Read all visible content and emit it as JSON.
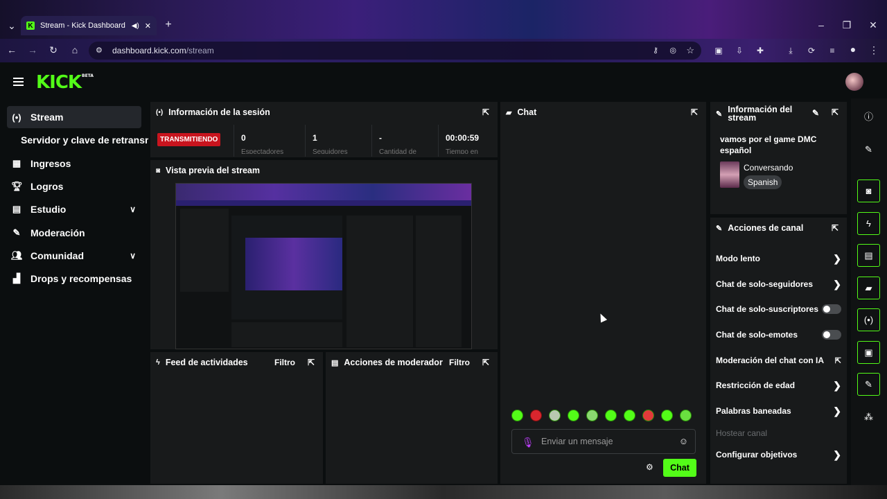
{
  "browser": {
    "tab_title": "Stream - Kick Dashboard",
    "url_domain": "dashboard.kick.com",
    "url_path": "/stream"
  },
  "brand": {
    "logo": "KICK",
    "beta": "BETA",
    "accent": "#53fc18"
  },
  "sidebar": {
    "items": [
      {
        "label": "Stream",
        "icon": "broadcast-icon"
      },
      {
        "label": "Servidor y clave de retransmisión"
      },
      {
        "label": "Ingresos",
        "icon": "chart-icon"
      },
      {
        "label": "Logros",
        "icon": "trophy-icon"
      },
      {
        "label": "Estudio",
        "icon": "studio-icon"
      },
      {
        "label": "Moderación",
        "icon": "wrench-icon"
      },
      {
        "label": "Comunidad",
        "icon": "users-icon"
      },
      {
        "label": "Drops y recompensas",
        "icon": "drops-icon"
      }
    ]
  },
  "session": {
    "title": "Información de la sesión",
    "status": "TRANSMITIENDO",
    "stats": [
      {
        "value": "0",
        "label": "Espectadores"
      },
      {
        "value": "1",
        "label": "Seguidores"
      },
      {
        "value": "-",
        "label": "Cantidad de"
      },
      {
        "value": "00:00:59",
        "label": "Tiempo en"
      }
    ]
  },
  "preview": {
    "title": "Vista previa del stream"
  },
  "feed": {
    "title": "Feed de actividades",
    "filter": "Filtro"
  },
  "modactions": {
    "title": "Acciones de moderador",
    "filter": "Filtro"
  },
  "chat": {
    "title": "Chat",
    "placeholder": "Enviar un mensaje",
    "send": "Chat",
    "emote_count": 10
  },
  "stream_info": {
    "title": "Información del stream",
    "stream_title": "vamos por el game DMC español",
    "category": "Conversando",
    "language": "Spanish"
  },
  "channel_actions": {
    "title": "Acciones de canal",
    "items": [
      {
        "label": "Modo lento",
        "control": "chevron"
      },
      {
        "label": "Chat de solo-seguidores",
        "control": "chevron"
      },
      {
        "label": "Chat de solo-suscriptores",
        "control": "toggle"
      },
      {
        "label": "Chat de solo-emotes",
        "control": "toggle"
      },
      {
        "label": "Moderación del chat con IA",
        "control": "external"
      },
      {
        "label": "Restricción de edad",
        "control": "chevron"
      },
      {
        "label": "Palabras baneadas",
        "control": "chevron"
      },
      {
        "label": "Hostear canal",
        "control": "none"
      },
      {
        "label": "Configurar objetivos",
        "control": "chevron"
      }
    ]
  }
}
